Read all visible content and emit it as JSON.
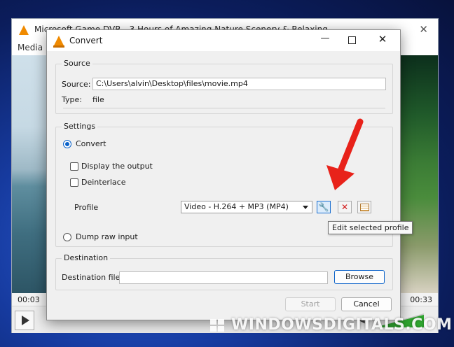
{
  "vlc": {
    "title": "Microsoft Game DVR - 3 Hours of Amazing Nature Scenery & Relaxing Music for",
    "close_glyph": "✕",
    "menu_media": "Media",
    "time_elapsed": "00:03",
    "time_total": "00:33",
    "speaker_glyph": "◀)"
  },
  "dialog": {
    "title": "Convert",
    "source": {
      "group_label": "Source",
      "source_label": "Source:",
      "source_value": "C:\\Users\\alvin\\Desktop\\files\\movie.mp4",
      "type_label": "Type:",
      "type_value": "file"
    },
    "settings": {
      "group_label": "Settings",
      "convert_label": "Convert",
      "display_output_label": "Display the output",
      "deinterlace_label": "Deinterlace",
      "profile_label": "Profile",
      "profile_value": "Video - H.264 + MP3 (MP4)",
      "dump_raw_label": "Dump raw input",
      "tooltip": "Edit selected profile"
    },
    "destination": {
      "group_label": "Destination",
      "dest_file_label": "Destination file:",
      "dest_file_value": "",
      "browse_label": "Browse"
    },
    "start_label": "Start",
    "cancel_label": "Cancel"
  },
  "watermark": "WINDOWSDIGITALS.COM",
  "colors": {
    "accent": "#0a62c9",
    "arrow": "#e8221a",
    "vlc_orange": "#f08a00"
  }
}
